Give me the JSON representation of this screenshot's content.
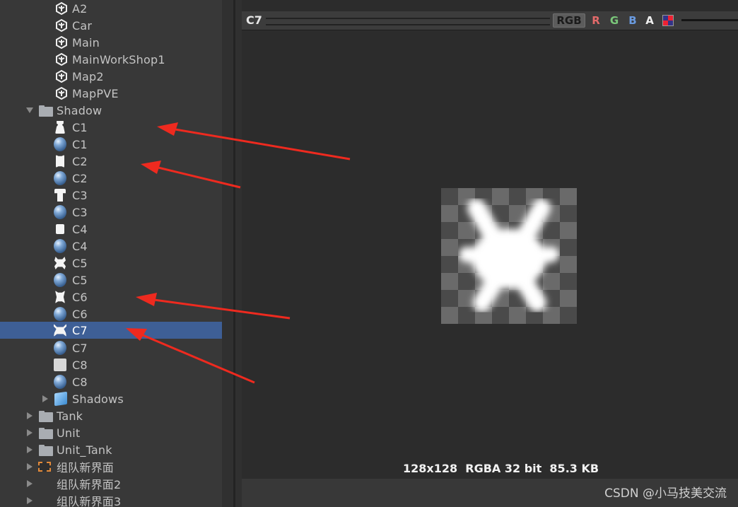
{
  "project_tree": {
    "items": [
      {
        "label": "A2",
        "icon": "unity-scene-icon"
      },
      {
        "label": "Car",
        "icon": "unity-scene-icon"
      },
      {
        "label": "Main",
        "icon": "unity-scene-icon"
      },
      {
        "label": "MainWorkShop1",
        "icon": "unity-scene-icon"
      },
      {
        "label": "Map2",
        "icon": "unity-scene-icon"
      },
      {
        "label": "MapPVE",
        "icon": "unity-scene-icon"
      },
      {
        "label": "Shadow",
        "icon": "folder-icon",
        "expanded": true
      },
      {
        "label": "C1",
        "icon": "texture-icon"
      },
      {
        "label": "C1",
        "icon": "material-icon"
      },
      {
        "label": "C2",
        "icon": "texture-icon"
      },
      {
        "label": "C2",
        "icon": "material-icon"
      },
      {
        "label": "C3",
        "icon": "texture-icon"
      },
      {
        "label": "C3",
        "icon": "material-icon"
      },
      {
        "label": "C4",
        "icon": "texture-icon"
      },
      {
        "label": "C4",
        "icon": "material-icon"
      },
      {
        "label": "C5",
        "icon": "texture-icon"
      },
      {
        "label": "C5",
        "icon": "material-icon"
      },
      {
        "label": "C6",
        "icon": "texture-icon"
      },
      {
        "label": "C6",
        "icon": "material-icon"
      },
      {
        "label": "C7",
        "icon": "texture-icon",
        "selected": true
      },
      {
        "label": "C7",
        "icon": "material-icon"
      },
      {
        "label": "C8",
        "icon": "texture-icon"
      },
      {
        "label": "C8",
        "icon": "material-icon"
      },
      {
        "label": "Shadows",
        "icon": "prefab-icon",
        "expanded": false
      },
      {
        "label": "Tank",
        "icon": "folder-icon",
        "expanded": false
      },
      {
        "label": "Unit",
        "icon": "folder-icon",
        "expanded": false
      },
      {
        "label": "Unit_Tank",
        "icon": "folder-icon",
        "expanded": false
      },
      {
        "label": "组队新界面",
        "icon": "ui-prefab-icon",
        "expanded": false
      },
      {
        "label": "组队新界面2",
        "icon": "",
        "expanded": false
      },
      {
        "label": "组队新界面3",
        "icon": "",
        "expanded": false
      }
    ]
  },
  "preview": {
    "title": "C7",
    "channels": {
      "rgb": "RGB",
      "r": "R",
      "g": "G",
      "b": "B",
      "a": "A"
    },
    "info": "128x128  RGBA 32 bit  85.3 KB"
  },
  "colors": {
    "selection": "#3e5f96",
    "annotation_arrow": "#ee2a1f"
  },
  "watermark": "CSDN @小马技美交流"
}
